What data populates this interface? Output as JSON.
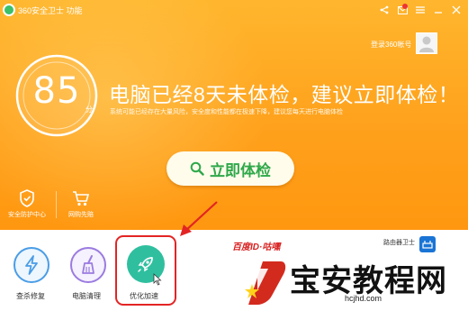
{
  "titlebar": {
    "app_title": "360安全卫士 功能",
    "controls": [
      "share-icon",
      "mail-icon",
      "menu-icon",
      "minimize-icon",
      "close-icon"
    ]
  },
  "account": {
    "login_text": "登录360帐号"
  },
  "score": {
    "value": "85",
    "unit": "分"
  },
  "headline": "电脑已经8天未体检，建议立即体检！",
  "subline": "系统可能已经存在大量风险，安全度和性能都在极速下降，建议您每天进行电脑体检",
  "check_button": {
    "label": "立即体检",
    "icon": "search-icon"
  },
  "hero_tools": [
    {
      "label": "安全防护中心",
      "icon": "shield-icon"
    },
    {
      "label": "网购先赔",
      "icon": "cart-icon"
    }
  ],
  "bottom_tools": [
    {
      "label": "查杀修复",
      "icon": "lightning-icon",
      "color": "#4a9de6"
    },
    {
      "label": "电脑清理",
      "icon": "broom-icon",
      "color": "#9b7be0"
    },
    {
      "label": "优化加速",
      "icon": "rocket-icon",
      "color": "#2fbf9f"
    }
  ],
  "annotation": {
    "baidu_id": "百度ID·咕嘿",
    "highlight_color": "#e32424"
  },
  "router": {
    "label": "路由器卫士"
  },
  "watermark": {
    "title": "宝安教程网",
    "url": "hcjhd.com"
  },
  "colors": {
    "hero_orange": "#ffa11c",
    "accent_green": "#2fa84a"
  }
}
